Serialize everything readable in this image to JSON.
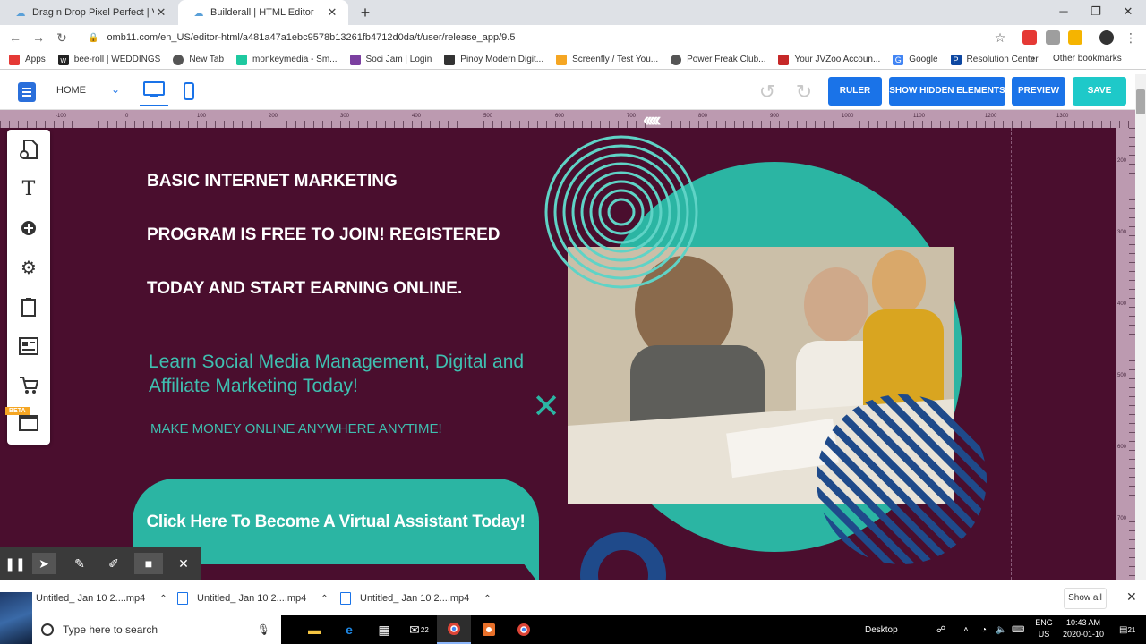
{
  "browser": {
    "tabs": [
      {
        "title": "Drag n Drop Pixel Perfect | Virtua",
        "active": false
      },
      {
        "title": "Builderall | HTML Editor",
        "active": true
      }
    ],
    "url": "omb11.com/en_US/editor-html/a481a47a1ebc9578b13261fb4712d0da/t/user/release_app/9.5",
    "bookmarks": [
      "Apps",
      "bee-roll | WEDDINGS",
      "New Tab",
      "monkeymedia - Sm...",
      "Soci Jam | Login",
      "Pinoy Modern Digit...",
      "Screenfly / Test You...",
      "Power Freak Club...",
      "Your JVZoo Accoun...",
      "Google",
      "Resolution Center"
    ],
    "bookmarks_more": "»",
    "other_bookmarks": "Other bookmarks"
  },
  "editor": {
    "page_name": "HOME",
    "buttons": {
      "ruler": "RULER",
      "show_hidden": "SHOW HIDDEN ELEMENTS",
      "preview": "PREVIEW",
      "save": "SAVE"
    },
    "ruler_labels": [
      "-100",
      "0",
      "100",
      "200",
      "300",
      "400",
      "500",
      "600",
      "700",
      "800",
      "900",
      "1000",
      "1100",
      "1200",
      "1300"
    ],
    "vruler_labels": [
      "200",
      "300",
      "400",
      "500",
      "600",
      "700"
    ],
    "beta_label": "BETA"
  },
  "canvas": {
    "headline": [
      "BASIC INTERNET MARKETING",
      "PROGRAM IS FREE TO JOIN! REGISTERED",
      "TODAY AND START EARNING ONLINE."
    ],
    "subhead": "Learn Social Media Management, Digital and Affiliate Marketing Today!",
    "tagline": "MAKE MONEY ONLINE ANYWHERE ANYTIME!",
    "cta": "Click Here To Become A Virtual Assistant Today!",
    "chevrons": "‹‹‹‹‹",
    "colors": {
      "background": "#4a0e2e",
      "teal": "#2bb5a3",
      "navy": "#1f4a8a"
    }
  },
  "downloads": {
    "items": [
      "Untitled_ Jan 10 2....mp4",
      "Untitled_ Jan 10 2....mp4",
      "Untitled_ Jan 10 2....mp4"
    ],
    "show_all": "Show all"
  },
  "taskbar": {
    "search_placeholder": "Type here to search",
    "mail_badge": "22",
    "desktop_label": "Desktop",
    "lang": [
      "ENG",
      "US"
    ],
    "time": "10:43 AM",
    "date": "2020-01-10",
    "notification_count": "21"
  }
}
